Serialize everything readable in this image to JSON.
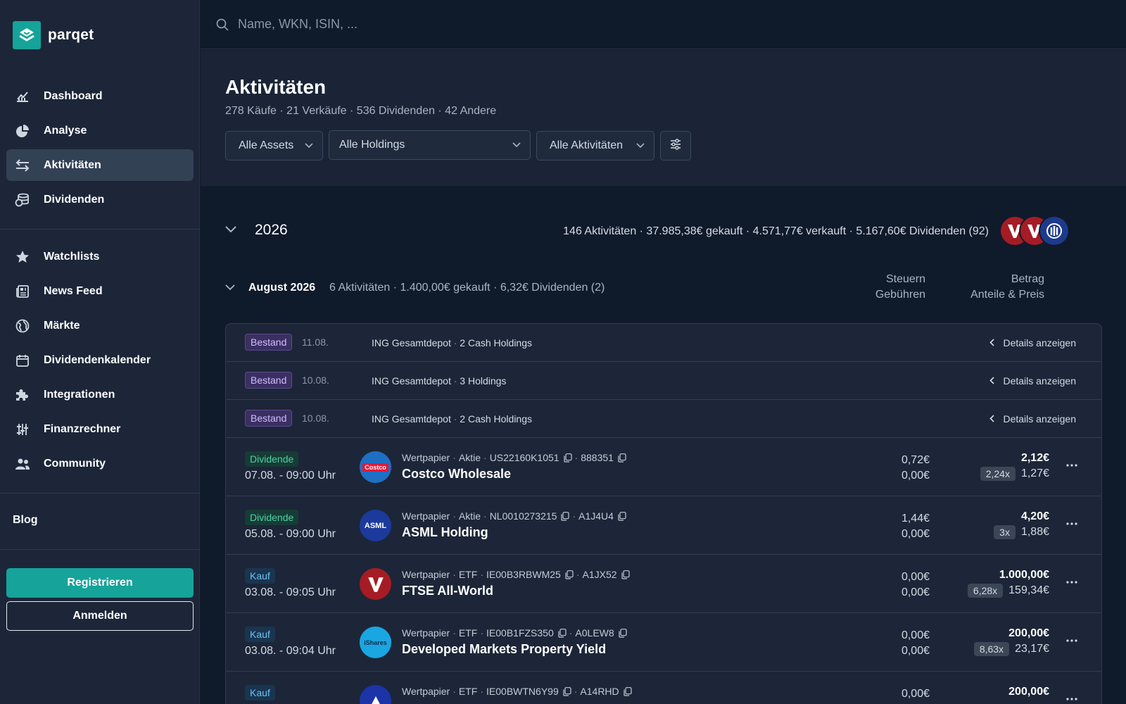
{
  "brand": {
    "name": "parqet",
    "color": "#15a39a"
  },
  "search": {
    "placeholder": "Name, WKN, ISIN, ..."
  },
  "sidebar": {
    "items": [
      {
        "label": "Dashboard",
        "icon": "chart-line-icon"
      },
      {
        "label": "Analyse",
        "icon": "pie-chart-icon"
      },
      {
        "label": "Aktivitäten",
        "icon": "arrows-exchange-icon",
        "active": true
      },
      {
        "label": "Dividenden",
        "icon": "coins-icon"
      },
      {
        "label": "Watchlists",
        "icon": "star-icon"
      },
      {
        "label": "News Feed",
        "icon": "newspaper-icon"
      },
      {
        "label": "Märkte",
        "icon": "globe-icon"
      },
      {
        "label": "Dividendenkalender",
        "icon": "calendar-icon"
      },
      {
        "label": "Integrationen",
        "icon": "puzzle-icon"
      },
      {
        "label": "Finanzrechner",
        "icon": "sliders-icon"
      },
      {
        "label": "Community",
        "icon": "users-icon"
      }
    ],
    "blog": "Blog",
    "register": "Registrieren",
    "login": "Anmelden"
  },
  "header": {
    "title": "Aktivitäten",
    "subtitle": "278 Käufe · 21 Verkäufe · 536 Dividenden · 42 Andere",
    "filters": {
      "assets": "Alle Assets",
      "holdings": "Alle Holdings",
      "activities": "Alle Aktivitäten"
    }
  },
  "year": {
    "label": "2026",
    "summary": "146 Aktivitäten · 37.985,38€ gekauft · 4.571,77€ verkauft · 5.167,60€ Dividenden (92)"
  },
  "month": {
    "label": "August 2026",
    "summary": "6 Aktivitäten  · 1.400,00€ gekauft  · 6,32€ Dividenden (2)",
    "col_tax": "Steuern",
    "col_fees": "Gebühren",
    "col_amount": "Betrag",
    "col_shares": "Anteile & Preis"
  },
  "holdings_rows": [
    {
      "badge": "Bestand",
      "date": "11.08.",
      "depot": "ING Gesamtdepot",
      "info": "2 Cash Holdings",
      "action": "Details anzeigen"
    },
    {
      "badge": "Bestand",
      "date": "10.08.",
      "depot": "ING Gesamtdepot",
      "info": "3 Holdings",
      "action": "Details anzeigen"
    },
    {
      "badge": "Bestand",
      "date": "10.08.",
      "depot": "ING Gesamtdepot",
      "info": "2 Cash Holdings",
      "action": "Details anzeigen"
    }
  ],
  "activity_rows": [
    {
      "badge": "Dividende",
      "datetime": "07.08. - 09:00 Uhr",
      "type": "Wertpapier",
      "kind": "Aktie",
      "isin": "US22160K1051",
      "wkn": "888351",
      "name": "Costco Wholesale",
      "tax": "0,72€",
      "fees": "0,00€",
      "amount": "2,12€",
      "shares": "2,24x",
      "price": "1,27€",
      "logo_text": "Costco",
      "logo_bg": "#1f6fc5"
    },
    {
      "badge": "Dividende",
      "datetime": "05.08. - 09:00 Uhr",
      "type": "Wertpapier",
      "kind": "Aktie",
      "isin": "NL0010273215",
      "wkn": "A1J4U4",
      "name": "ASML Holding",
      "tax": "1,44€",
      "fees": "0,00€",
      "amount": "4,20€",
      "shares": "3x",
      "price": "1,88€",
      "logo_text": "ASML",
      "logo_bg": "#1b3a9c"
    },
    {
      "badge": "Kauf",
      "datetime": "03.08. - 09:05 Uhr",
      "type": "Wertpapier",
      "kind": "ETF",
      "isin": "IE00B3RBWM25",
      "wkn": "A1JX52",
      "name": "FTSE All-World",
      "tax": "0,00€",
      "fees": "0,00€",
      "amount": "1.000,00€",
      "shares": "6,28x",
      "price": "159,34€",
      "logo_text": "V",
      "logo_bg": "#a51c24"
    },
    {
      "badge": "Kauf",
      "datetime": "03.08. - 09:04 Uhr",
      "type": "Wertpapier",
      "kind": "ETF",
      "isin": "IE00B1FZS350",
      "wkn": "A0LEW8",
      "name": "Developed Markets Property Yield",
      "tax": "0,00€",
      "fees": "0,00€",
      "amount": "200,00€",
      "shares": "8,63x",
      "price": "23,17€",
      "logo_text": "iShares",
      "logo_bg": "#1aa6e0"
    },
    {
      "badge": "Kauf",
      "datetime": "",
      "type": "Wertpapier",
      "kind": "ETF",
      "isin": "IE00BWTN6Y99",
      "wkn": "A14RHD",
      "name": "",
      "tax": "0,00€",
      "fees": "",
      "amount": "200,00€",
      "shares": "",
      "price": "",
      "logo_text": "",
      "logo_bg": "#1d33a8"
    }
  ]
}
